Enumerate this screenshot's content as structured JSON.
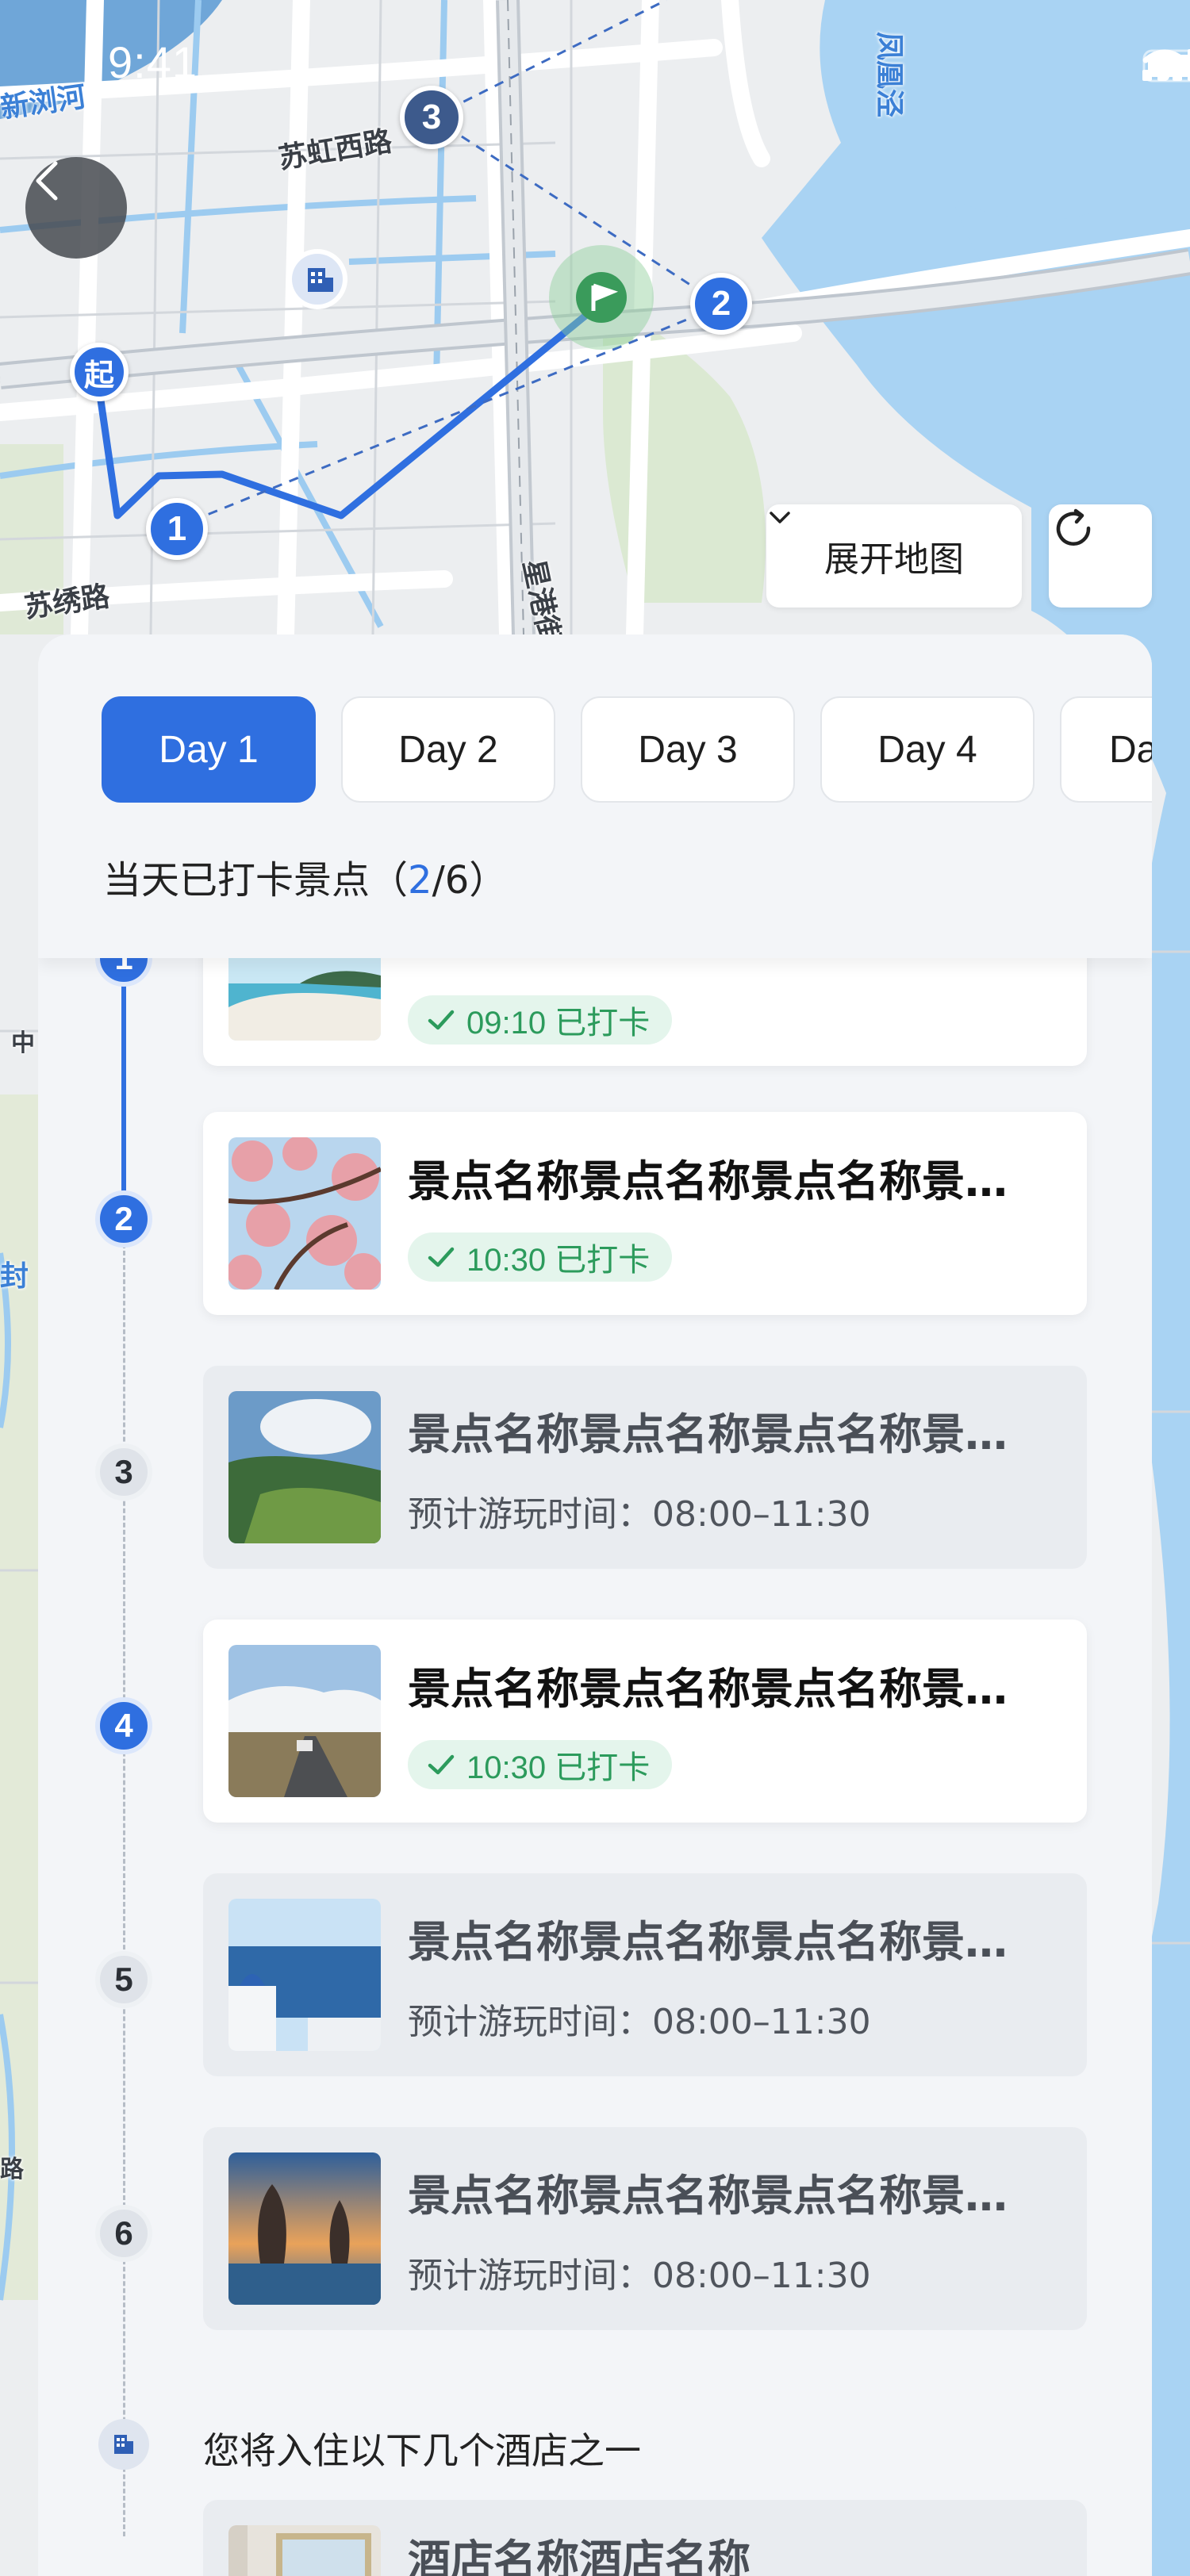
{
  "status_bar": {
    "time": "9:41"
  },
  "map": {
    "road_labels": [
      "苏虹西路",
      "苏绣路",
      "星港街隧道",
      "新浏河",
      "凤凰泾",
      "中",
      "封",
      "路"
    ],
    "route_markers": [
      {
        "label": "起",
        "color": "#2f6fe0"
      },
      {
        "label": "1",
        "color": "#2f6fe0"
      },
      {
        "label": "2",
        "color": "#2f6fe0"
      },
      {
        "label": "3",
        "color": "#3d5a8c"
      }
    ],
    "poi_icons": [
      "hotel-icon",
      "flag-icon"
    ],
    "expand_map_label": "展开地图",
    "refresh_icon": "refresh-icon",
    "back_icon": "back-arrow-icon"
  },
  "panel": {
    "tabs": [
      {
        "label": "Day 1",
        "active": true
      },
      {
        "label": "Day 2",
        "active": false
      },
      {
        "label": "Day 3",
        "active": false
      },
      {
        "label": "Day 4",
        "active": false
      },
      {
        "label": "Da",
        "active": false
      }
    ],
    "checkin_summary": {
      "prefix": "当天已打卡景点（",
      "done": "2",
      "sep": "/",
      "total": "6",
      "suffix": "）"
    },
    "spots": [
      {
        "index": "1",
        "status": "done",
        "badge": "09:10 已打卡",
        "thumb": "beach"
      },
      {
        "index": "2",
        "status": "done",
        "title": "景点名称景点名称景点名称景点名称",
        "badge": "10:30 已打卡",
        "thumb": "blossom"
      },
      {
        "index": "3",
        "status": "todo",
        "title": "景点名称景点名称景点名称景点名称",
        "plan": "预计游玩时间：08:00–11:30",
        "thumb": "valley"
      },
      {
        "index": "4",
        "status": "done",
        "title": "景点名称景点名称景点名称景点名称",
        "badge": "10:30 已打卡",
        "thumb": "road"
      },
      {
        "index": "5",
        "status": "todo",
        "title": "景点名称景点名称景点名称景点名称",
        "plan": "预计游玩时间：08:00–11:30",
        "thumb": "santorini"
      },
      {
        "index": "6",
        "status": "todo",
        "title": "景点名称景点名称景点名称景点名称",
        "plan": "预计游玩时间：08:00–11:30",
        "thumb": "towers"
      }
    ],
    "hotel_section_title": "您将入住以下几个酒店之一",
    "hotel": {
      "title": "酒店名称酒店名称"
    }
  },
  "colors": {
    "accent": "#2f6fe0",
    "checked": "#2c9b5c",
    "water": "#a9d3f3"
  }
}
